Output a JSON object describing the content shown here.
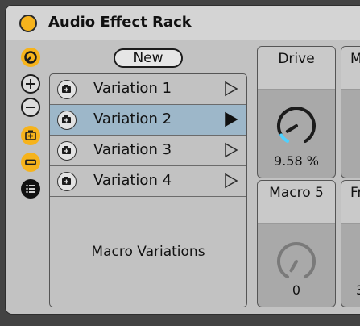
{
  "device": {
    "title": "Audio Effect Rack",
    "power_on": true
  },
  "sidebar": {
    "items": [
      {
        "name": "macro-toggle-icon",
        "active": true
      },
      {
        "name": "add-macro-icon",
        "active": false
      },
      {
        "name": "remove-macro-icon",
        "active": false
      },
      {
        "name": "randomize-icon",
        "active": true
      },
      {
        "name": "show-variations-icon",
        "active": true
      },
      {
        "name": "chain-list-icon",
        "active": true
      }
    ]
  },
  "variations": {
    "new_label": "New",
    "items": [
      {
        "label": "Variation 1",
        "selected": false
      },
      {
        "label": "Variation 2",
        "selected": true
      },
      {
        "label": "Variation 3",
        "selected": false
      },
      {
        "label": "Variation 4",
        "selected": false
      }
    ],
    "panel_label": "Macro Variations"
  },
  "macros": [
    {
      "name": "Drive",
      "value": "9.58 %",
      "level": 0.0958
    },
    {
      "name": "M",
      "value": ""
    },
    {
      "name": "Macro 5",
      "value": "0",
      "level": 0
    },
    {
      "name": "Fr",
      "value": "3"
    }
  ],
  "colors": {
    "accent": "#f6b31c",
    "selected_row": "#9db7c9",
    "knob_arc": "#4fd1ff"
  }
}
